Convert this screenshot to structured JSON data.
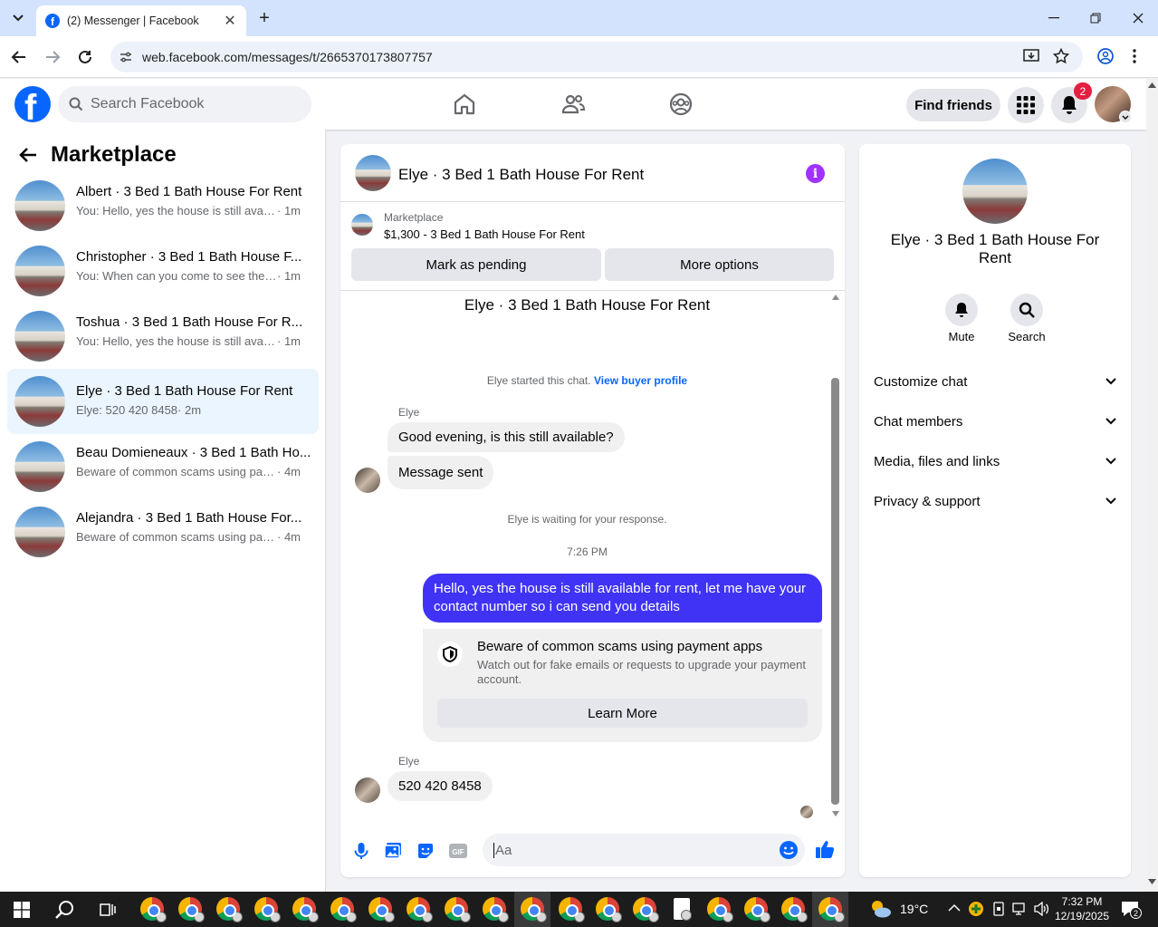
{
  "browser": {
    "tab_title": "(2) Messenger | Facebook",
    "url": "web.facebook.com/messages/t/2665370173807757"
  },
  "header": {
    "search_placeholder": "Search Facebook",
    "find_friends": "Find friends",
    "notification_count": "2"
  },
  "sidebar": {
    "title": "Marketplace",
    "conversations": [
      {
        "name": "Albert · 3 Bed 1 Bath House For Rent",
        "preview": "You: Hello, yes the house is still availa...",
        "time": "· 1m"
      },
      {
        "name": "Christopher · 3 Bed 1 Bath House F...",
        "preview": "You: When can you come to see the ...",
        "time": "· 1m"
      },
      {
        "name": "Toshua · 3 Bed 1 Bath House For R...",
        "preview": "You: Hello, yes the house is still availa...",
        "time": "· 1m"
      },
      {
        "name": "Elye · 3 Bed 1 Bath House For Rent",
        "preview": "Elye: 520 420 8458",
        "time": "· 2m"
      },
      {
        "name": "Beau Domieneaux · 3 Bed 1 Bath Ho...",
        "preview": "Beware of common scams using pay...",
        "time": "· 4m"
      },
      {
        "name": "Alejandra · 3 Bed 1 Bath House For...",
        "preview": "Beware of common scams using pay...",
        "time": "· 4m"
      }
    ]
  },
  "chat": {
    "title": "Elye · 3 Bed 1 Bath House For Rent",
    "listing_label": "Marketplace",
    "listing_price": "$1,300 - 3 Bed 1 Bath House For Rent",
    "mark_pending": "Mark as pending",
    "more_options": "More options",
    "thread_title": "Elye · 3 Bed 1 Bath House For Rent",
    "started_text": "Elye started this chat.",
    "view_profile": "View buyer profile",
    "sender1": "Elye",
    "msg1": "Good evening, is this still available?",
    "msg2": "Message sent",
    "waiting": "Elye is waiting for your response.",
    "time": "7:26 PM",
    "out_msg": "Hello, yes the house is still available for rent, let me have your contact number so i can send you  details",
    "scam_title": "Beware of common scams using payment apps",
    "scam_body": "Watch out for fake emails or requests to upgrade your payment account.",
    "learn_more": "Learn More",
    "sender2": "Elye",
    "msg3": "520 420 8458",
    "input_placeholder": "Aa"
  },
  "info_panel": {
    "name": "Elye · 3 Bed 1 Bath House For Rent",
    "mute": "Mute",
    "search": "Search",
    "sections": [
      "Customize chat",
      "Chat members",
      "Media, files and links",
      "Privacy & support"
    ]
  },
  "taskbar": {
    "temperature": "19°C",
    "time": "7:32 PM",
    "date": "12/19/2025",
    "notif": "2"
  },
  "colors": {
    "fb_blue": "#0866ff",
    "bubble_out": "#4033f6",
    "info_purple": "#a033ff",
    "badge_red": "#e41e3f"
  }
}
